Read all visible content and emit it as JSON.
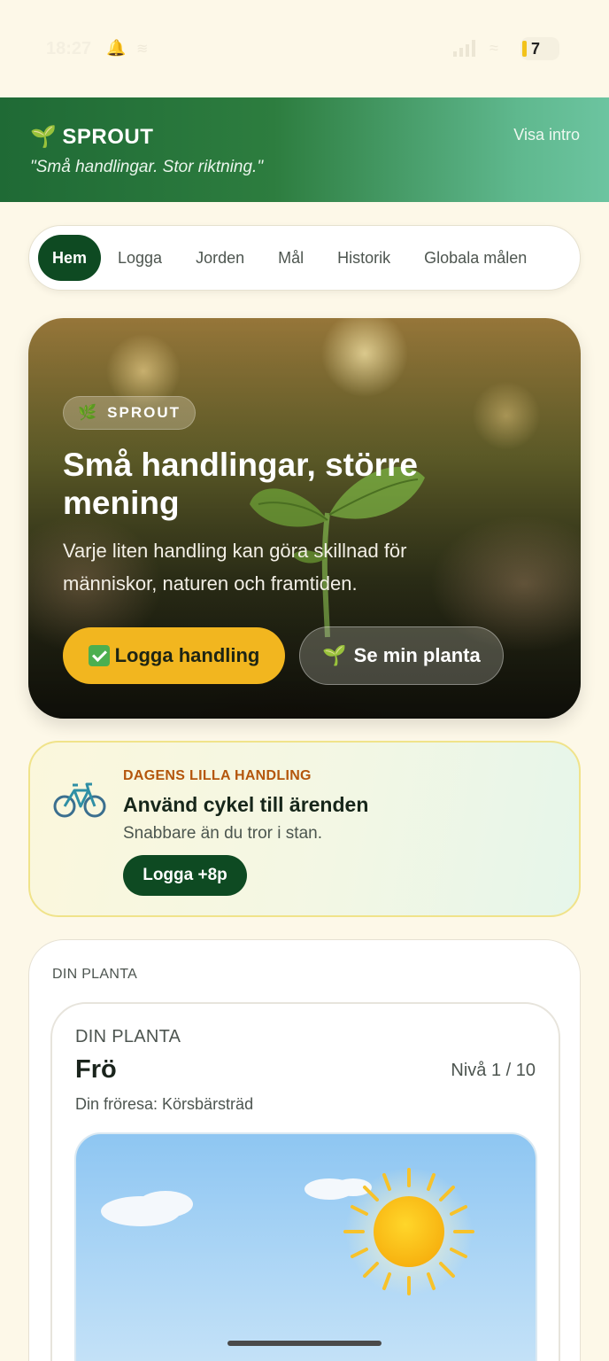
{
  "status_bar": {
    "time": "18:27",
    "battery": "7"
  },
  "header": {
    "brand_icon": "seedling-icon",
    "brand": "SPROUT",
    "tagline": "\"Små handlingar. Stor riktning.\"",
    "intro_link": "Visa intro"
  },
  "tabs": [
    {
      "label": "Hem",
      "active": true
    },
    {
      "label": "Logga"
    },
    {
      "label": "Jorden"
    },
    {
      "label": "Mål"
    },
    {
      "label": "Historik"
    },
    {
      "label": "Globala målen"
    }
  ],
  "hero": {
    "badge_icon": "herb-icon",
    "badge": "SPROUT",
    "title": "Små handlingar, större mening",
    "subtitle": "Varje liten handling kan göra skillnad för människor, naturen och framtiden.",
    "primary_button": "Logga handling",
    "secondary_button": "Se min planta"
  },
  "daily": {
    "icon": "bicycle-icon",
    "eyebrow": "DAGENS LILLA HANDLING",
    "headline": "Använd cykel till ärenden",
    "description": "Snabbare än du tror i stan.",
    "button": "Logga +8p"
  },
  "plant": {
    "section_label": "DIN PLANTA",
    "card_label": "DIN PLANTA",
    "stage": "Frö",
    "level": "Nivå 1 / 10",
    "seed": "Din fröresa: Körsbärsträd"
  },
  "colors": {
    "brand_dark": "#0e4a22",
    "accent_yellow": "#f2b61f",
    "eyebrow_orange": "#b4560c",
    "background": "#fdf8e8"
  }
}
